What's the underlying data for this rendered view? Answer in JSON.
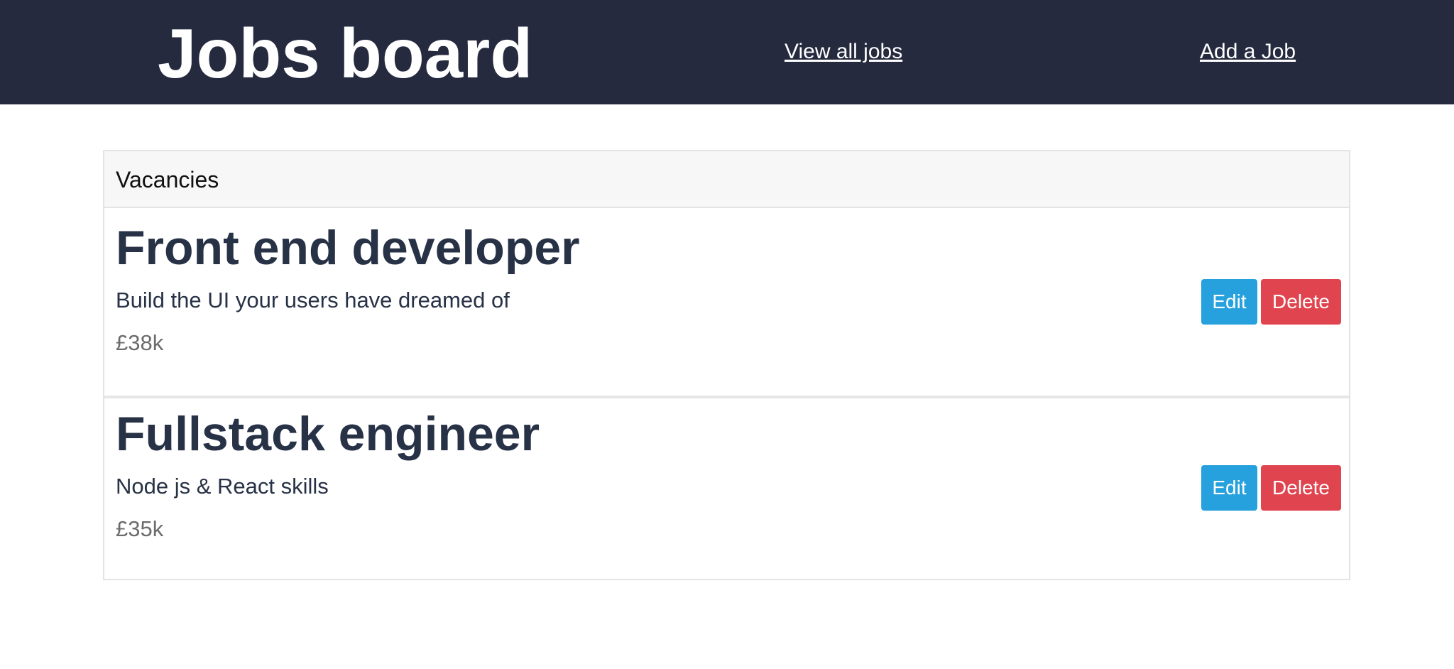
{
  "header": {
    "brand": "Jobs board",
    "nav": [
      {
        "label": "View all jobs"
      },
      {
        "label": "Add a Job"
      }
    ]
  },
  "panel": {
    "heading": "Vacancies",
    "jobs": [
      {
        "title": "Front end developer",
        "description": "Build the UI your users have dreamed of",
        "salary": "£38k",
        "edit_label": "Edit",
        "delete_label": "Delete"
      },
      {
        "title": "Fullstack engineer",
        "description": "Node js & React skills",
        "salary": "£35k",
        "edit_label": "Edit",
        "delete_label": "Delete"
      }
    ]
  },
  "colors": {
    "navbar_bg": "#252a3e",
    "edit_button": "#27a1dd",
    "delete_button": "#e0444e",
    "title_text": "#283246"
  }
}
